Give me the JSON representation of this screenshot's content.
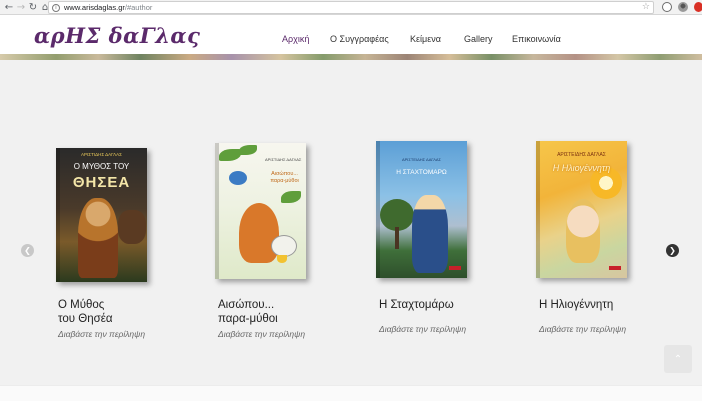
{
  "browser": {
    "url_host": "www.arisdaglas.gr",
    "url_path": "/#author",
    "info_icon": "info-icon",
    "star_icon": "star-icon"
  },
  "site": {
    "logo": "αρΗΣ δαΓλας"
  },
  "menu": {
    "items": [
      {
        "label": "Αρχική",
        "active": true
      },
      {
        "label": "Ο Συγγραφέας",
        "active": false
      },
      {
        "label": "Κείμενα",
        "active": false
      },
      {
        "label": "Gallery",
        "active": false
      },
      {
        "label": "Επικοινωνία",
        "active": false
      }
    ]
  },
  "books": [
    {
      "title_line1": "Ο Μύθος",
      "title_line2": "του Θησέα",
      "more": "Διαβάστε την περίληψη",
      "cover_author": "ΑΡΙΣΤΙΔΗΣ ΔΑΓΛΑΣ",
      "cover_title_small": "Ο ΜΥΘΟΣ ΤΟΥ",
      "cover_title_big": "ΘΗΣΕΑ"
    },
    {
      "title_line1": "Αισώπου...",
      "title_line2": "παρα-μύθοι",
      "more": "Διαβάστε την περίληψη",
      "cover_author": "ΑΡΙΣΤΙΔΗΣ ΔΑΓΛΑΣ",
      "cover_title": "Αισώπου... παρα-μύθοι"
    },
    {
      "title_line1": "Η Σταχτομάρω",
      "title_line2": "",
      "more": "Διαβάστε την περίληψη",
      "cover_author": "ΑΡΙΣΤΕΙΔΗΣ ΔΑΓΛΑΣ",
      "cover_title": "Η ΣΤΑΧΤΟΜΑΡΩ"
    },
    {
      "title_line1": "Η Ηλιογέννητη",
      "title_line2": "",
      "more": "Διαβάστε την περίληψη",
      "cover_author": "ΑΡΙΣΤΕΙΔΗΣ ΔΑΓΛΑΣ",
      "cover_title": "Η Ηλιογέννητη"
    }
  ],
  "carousel": {
    "prev_icon": "chevron-left-icon",
    "next_icon": "chevron-right-icon"
  },
  "scroll_top_icon": "chevron-up-icon"
}
